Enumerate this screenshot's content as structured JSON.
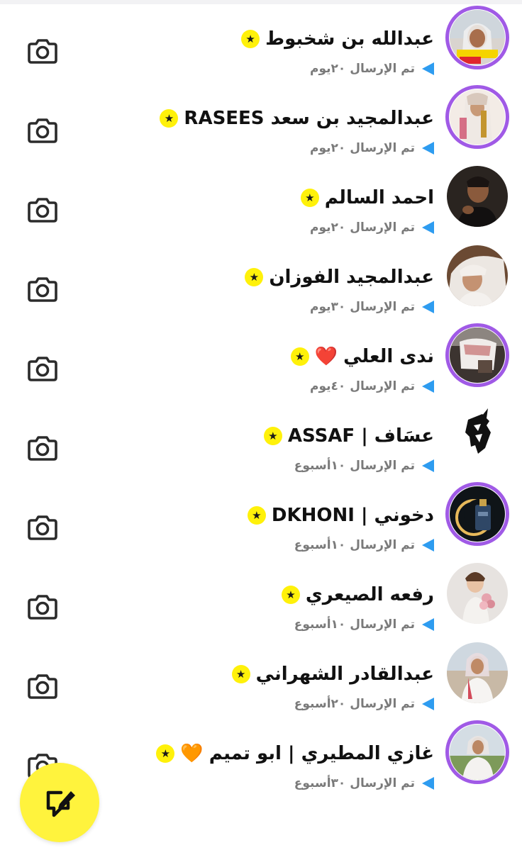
{
  "colors": {
    "story_ring": "#a05ae6",
    "sent_arrow": "#2e9cf0",
    "star_badge": "#fff10a",
    "fab": "#fff33d",
    "text": "#111111",
    "status_text": "#7a7a7a"
  },
  "chats": [
    {
      "name": "عبدالله بن شخبوط",
      "emoji": "",
      "status": "تم الإرسال ٢٠يوم",
      "has_story": true,
      "star_icon": "star-badge-icon",
      "avatar_icon": "avatar-photo"
    },
    {
      "name": "عبدالمجيد بن سعد RASEES",
      "emoji": "",
      "status": "تم الإرسال ٢٠يوم",
      "has_story": true,
      "star_icon": "star-badge-icon",
      "avatar_icon": "avatar-photo"
    },
    {
      "name": "احمد السالم",
      "emoji": "",
      "status": "تم الإرسال ٢٠يوم",
      "has_story": false,
      "star_icon": "star-badge-icon",
      "avatar_icon": "avatar-photo"
    },
    {
      "name": "عبدالمجيد الفوزان",
      "emoji": "",
      "status": "تم الإرسال ٣٠يوم",
      "has_story": false,
      "star_icon": "star-badge-icon",
      "avatar_icon": "avatar-photo"
    },
    {
      "name": "ندى العلي",
      "emoji": "❤️",
      "status": "تم الإرسال ٤٠يوم",
      "has_story": true,
      "star_icon": "star-badge-icon",
      "avatar_icon": "avatar-photo"
    },
    {
      "name": "عسَاف | ASSAF",
      "emoji": "",
      "status": "تم الإرسال ١٠أسبوع",
      "has_story": false,
      "star_icon": "star-badge-icon",
      "avatar_icon": "horse-logo"
    },
    {
      "name": "دخوني | DKHONI",
      "emoji": "",
      "status": "تم الإرسال ١٠أسبوع",
      "has_story": true,
      "star_icon": "star-badge-icon",
      "avatar_icon": "perfume-photo"
    },
    {
      "name": "رفعه الصيعري",
      "emoji": "",
      "status": "تم الإرسال ١٠أسبوع",
      "has_story": false,
      "star_icon": "star-badge-icon",
      "avatar_icon": "avatar-photo"
    },
    {
      "name": "عبدالقادر الشهراني",
      "emoji": "",
      "status": "تم الإرسال ٢٠أسبوع",
      "has_story": false,
      "star_icon": "star-badge-icon",
      "avatar_icon": "avatar-photo"
    },
    {
      "name": "غازي المطيري | ابو تميم",
      "emoji": "🧡",
      "status": "تم الإرسال ٣٠أسبوع",
      "has_story": true,
      "star_icon": "star-badge-icon",
      "avatar_icon": "avatar-photo"
    }
  ],
  "camera_icon": "camera-icon",
  "fab_icon": "new-chat-icon"
}
